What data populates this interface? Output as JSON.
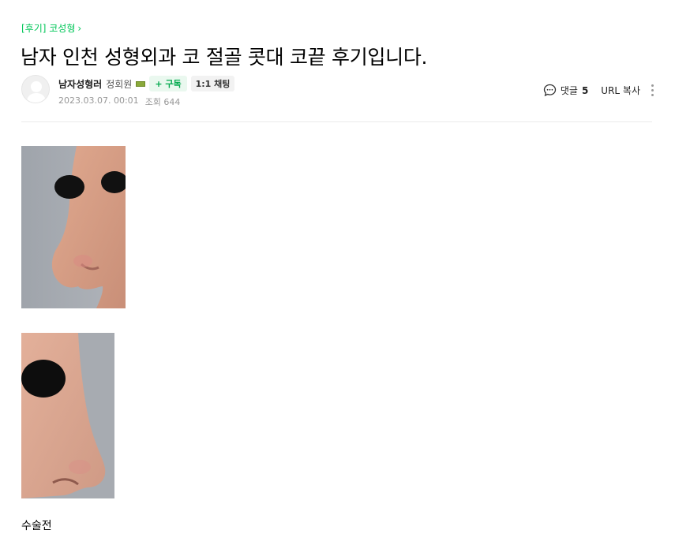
{
  "post": {
    "category": "[후기] 코성형",
    "title": "남자 인천 성형외과 코 절골 콧대 코끝 후기입니다."
  },
  "author": {
    "name": "남자성형러",
    "level": "정회원",
    "subscribe_label": "+ 구독",
    "chat_label": "1:1 채팅",
    "date": "2023.03.07. 00:01",
    "views": "조회 644"
  },
  "tools": {
    "comment_label": "댓글",
    "comment_count": "5",
    "url_copy_label": "URL 복사"
  },
  "content": {
    "caption": "수술전"
  },
  "colors": {
    "accent": "#03c75a",
    "skin": "#d7a08a",
    "background_gray": "#a3a7ae"
  }
}
